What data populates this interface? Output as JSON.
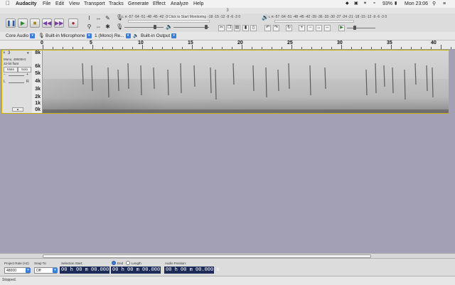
{
  "menubar": {
    "app": "Audacity",
    "items": [
      "File",
      "Edit",
      "View",
      "Transport",
      "Tracks",
      "Generate",
      "Effect",
      "Analyze",
      "Help"
    ],
    "battery": "93%",
    "clock": "Mon 23:06"
  },
  "window_title": "3",
  "meters": {
    "record_hint": "Click to Start Monitoring",
    "record_scale": "-57 -54 -51 -48 -45 -42 -39 -36 -33 -30 -27 -24 -21 -18 -15 -12 -9 -6 -3 0",
    "play_scale": "-57 -54 -51 -48 -45 -42 -39 -36 -33 -30 -27 -24 -21 -18 -15 -12 -9 -6 -3 0",
    "LR": "L R"
  },
  "device": {
    "host": "Core Audio",
    "mic": "Built-in Microphone",
    "channels": "1 (Mono) Re...",
    "output": "Built-in Output"
  },
  "ruler": {
    "ticks": [
      "0",
      "5",
      "10",
      "15",
      "20",
      "25",
      "30",
      "35",
      "40"
    ]
  },
  "track": {
    "name": "3",
    "info": "Mono, 48000Hz",
    "format": "32-bit float",
    "mute": "Mute",
    "solo": "Solo",
    "vlabels": [
      "8k",
      "6k",
      "5k",
      "4k",
      "3k",
      "2k",
      "1k",
      "0k"
    ]
  },
  "selection": {
    "project_rate_label": "Project Rate (Hz):",
    "project_rate": "48000",
    "snap_label": "Snap To:",
    "snap": "Off",
    "start_label": "Selection Start:",
    "end_option": "End",
    "length_option": "Length",
    "audio_position_label": "Audio Position:",
    "start_time": "00 h 00 m 00.000 s",
    "end_time": "00 h 00 m 00.000 s",
    "position_time": "00 h 00 m 00.000 s"
  },
  "status": "Stopped."
}
